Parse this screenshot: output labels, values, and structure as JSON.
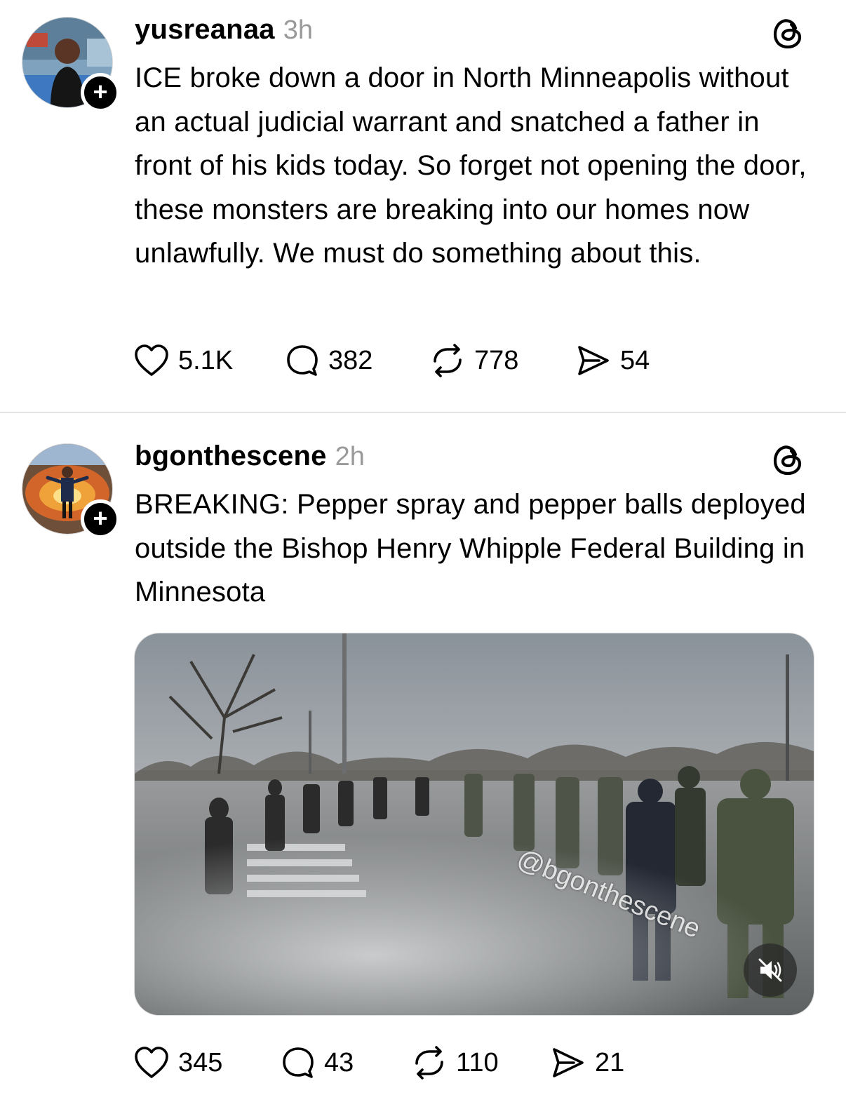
{
  "posts": [
    {
      "username": "yusreanaa",
      "time": "3h",
      "text": "ICE broke down a door in North Minneapolis without an actual judicial warrant and snatched a father in front of his kids today. So forget not opening the door, these monsters are breaking into our homes now unlawfully. We must do something about this.",
      "follow_icon": "plus-icon",
      "likes": "5.1K",
      "replies": "382",
      "reposts": "778",
      "shares": "54"
    },
    {
      "username": "bgonthescene",
      "time": "2h",
      "text": "BREAKING: Pepper spray and pepper balls deployed outside the Bishop Henry Whipple Federal Building in Minnesota",
      "follow_icon": "plus-icon",
      "video": {
        "watermark": "@bgonthescene",
        "mute_icon": "speaker-muted-icon"
      },
      "likes": "345",
      "replies": "43",
      "reposts": "110",
      "shares": "21"
    }
  ],
  "icons": {
    "like": "heart-icon",
    "reply": "speech-bubble-icon",
    "repost": "repost-arrows-icon",
    "share": "send-icon",
    "brand": "threads-logo-icon"
  },
  "colors": {
    "text": "#000000",
    "muted": "#9a9a9a",
    "divider": "#e4e4e4",
    "background": "#ffffff"
  }
}
